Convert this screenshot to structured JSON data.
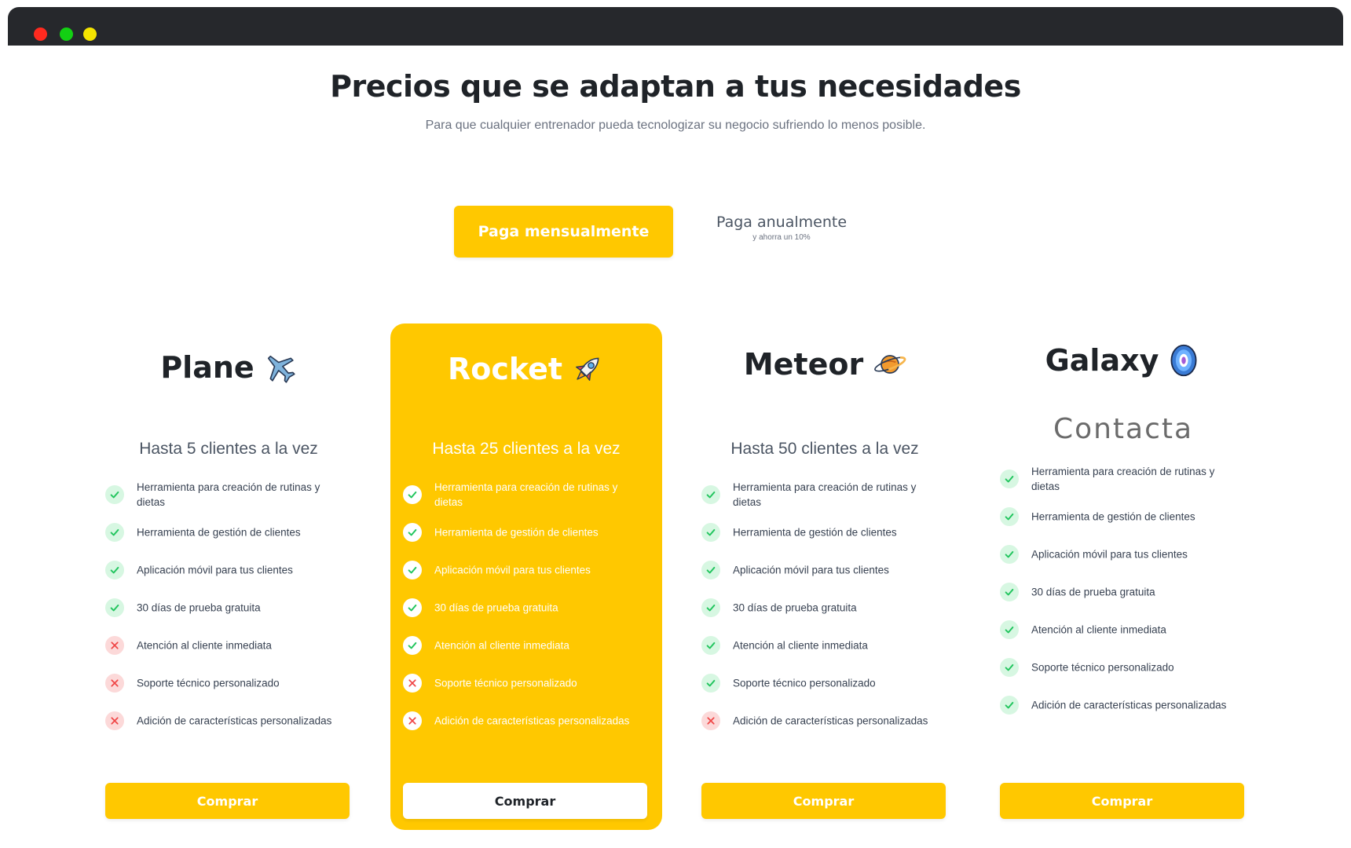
{
  "window": {
    "controls": [
      "close",
      "minimize",
      "maximize"
    ]
  },
  "header": {
    "title": "Precios que se adaptan a tus necesidades",
    "subtitle": "Para que cualquier entrenador pueda tecnologizar su negocio sufriendo lo menos posible."
  },
  "billing_toggle": {
    "monthly_label": "Paga mensualmente",
    "annual_label": "Paga anualmente",
    "annual_sub": "y ahorra un 10%",
    "selected": "monthly"
  },
  "colors": {
    "accent": "#ffc800",
    "check": "#22c55e",
    "cross": "#ef4444"
  },
  "plans": [
    {
      "name": "Plane",
      "icon": "airplane-icon",
      "clients": "Hasta 5 clientes a la vez",
      "contact": null,
      "highlight": false,
      "button": "Comprar",
      "features": [
        {
          "text": "Herramienta para creación de rutinas y dietas",
          "included": true
        },
        {
          "text": "Herramienta de gestión de clientes",
          "included": true
        },
        {
          "text": "Aplicación móvil para tus clientes",
          "included": true
        },
        {
          "text": "30 días de prueba gratuita",
          "included": true
        },
        {
          "text": "Atención al cliente inmediata",
          "included": false
        },
        {
          "text": "Soporte técnico personalizado",
          "included": false
        },
        {
          "text": "Adición de características personalizadas",
          "included": false
        }
      ]
    },
    {
      "name": "Rocket",
      "icon": "rocket-icon",
      "clients": "Hasta 25 clientes a la vez",
      "contact": null,
      "highlight": true,
      "button": "Comprar",
      "features": [
        {
          "text": "Herramienta para creación de rutinas y dietas",
          "included": true
        },
        {
          "text": "Herramienta de gestión de clientes",
          "included": true
        },
        {
          "text": "Aplicación móvil para tus clientes",
          "included": true
        },
        {
          "text": "30 días de prueba gratuita",
          "included": true
        },
        {
          "text": "Atención al cliente inmediata",
          "included": true
        },
        {
          "text": "Soporte técnico personalizado",
          "included": false
        },
        {
          "text": "Adición de características personalizadas",
          "included": false
        }
      ]
    },
    {
      "name": "Meteor",
      "icon": "planet-icon",
      "clients": "Hasta 50 clientes a la vez",
      "contact": null,
      "highlight": false,
      "button": "Comprar",
      "features": [
        {
          "text": "Herramienta para creación de rutinas y dietas",
          "included": true
        },
        {
          "text": "Herramienta de gestión de clientes",
          "included": true
        },
        {
          "text": "Aplicación móvil para tus clientes",
          "included": true
        },
        {
          "text": "30 días de prueba gratuita",
          "included": true
        },
        {
          "text": "Atención al cliente inmediata",
          "included": true
        },
        {
          "text": "Soporte técnico personalizado",
          "included": true
        },
        {
          "text": "Adición de características personalizadas",
          "included": false
        }
      ]
    },
    {
      "name": "Galaxy",
      "icon": "galaxy-icon",
      "clients": null,
      "contact": "Contacta",
      "highlight": false,
      "button": "Comprar",
      "features": [
        {
          "text": "Herramienta para creación de rutinas y dietas",
          "included": true
        },
        {
          "text": "Herramienta de gestión de clientes",
          "included": true
        },
        {
          "text": "Aplicación móvil para tus clientes",
          "included": true
        },
        {
          "text": "30 días de prueba gratuita",
          "included": true
        },
        {
          "text": "Atención al cliente inmediata",
          "included": true
        },
        {
          "text": "Soporte técnico personalizado",
          "included": true
        },
        {
          "text": "Adición de características personalizadas",
          "included": true
        }
      ]
    }
  ]
}
